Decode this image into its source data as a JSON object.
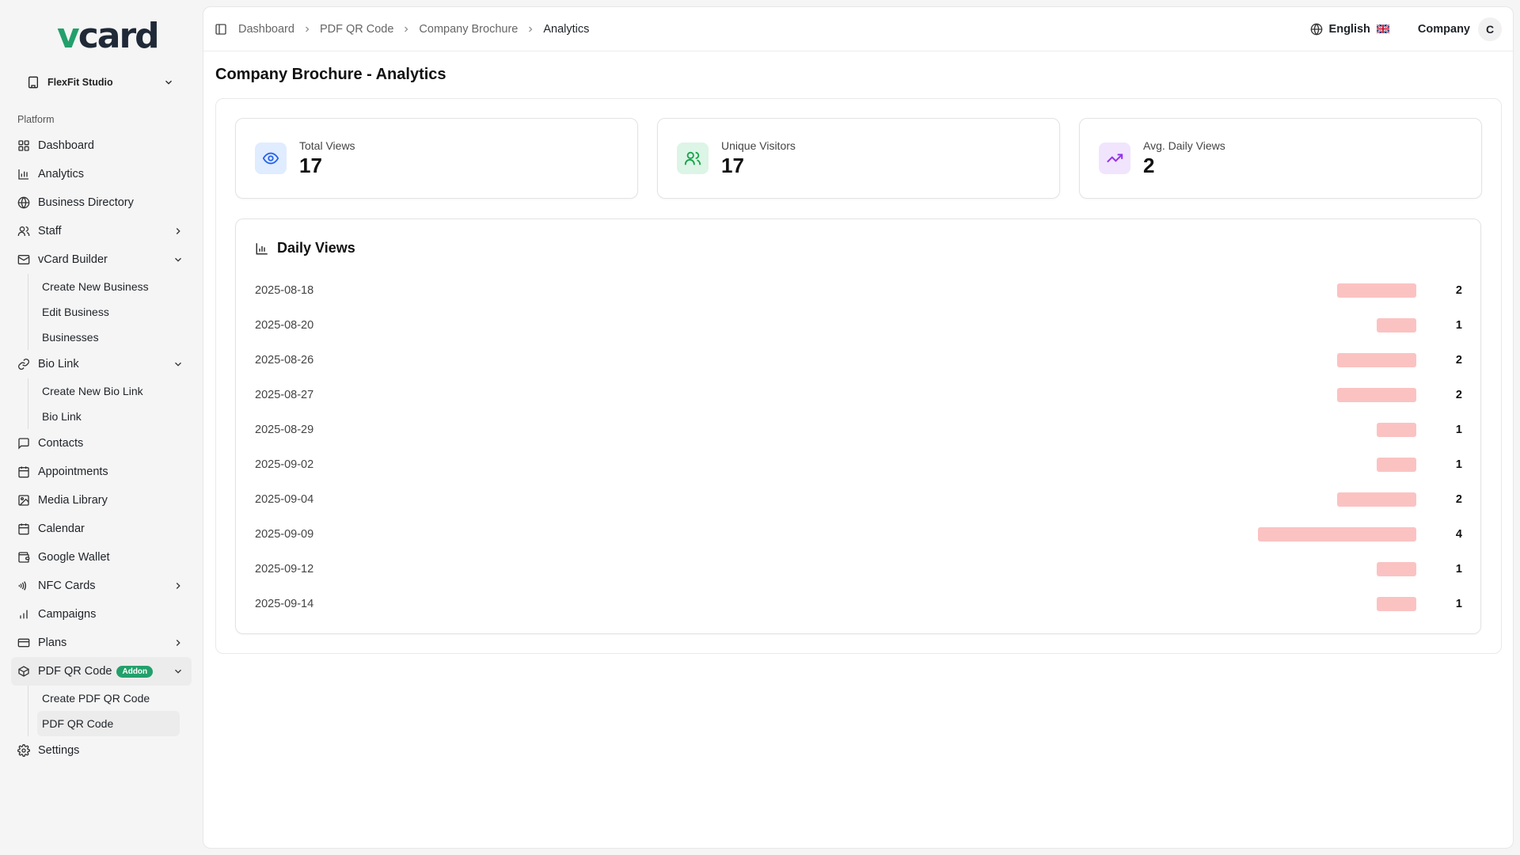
{
  "app": {
    "logo_v": "v",
    "logo_rest": "card"
  },
  "team": {
    "name": "FlexFit Studio"
  },
  "sidebar": {
    "section_label": "Platform",
    "items": [
      {
        "label": "Dashboard",
        "icon": "grid-icon"
      },
      {
        "label": "Analytics",
        "icon": "bar-chart-icon"
      },
      {
        "label": "Business Directory",
        "icon": "globe-icon"
      },
      {
        "label": "Staff",
        "icon": "users-icon"
      },
      {
        "label": "vCard Builder",
        "icon": "mail-icon"
      },
      {
        "label": "Create New Business"
      },
      {
        "label": "Edit Business"
      },
      {
        "label": "Businesses"
      },
      {
        "label": "Bio Link",
        "icon": "link-icon"
      },
      {
        "label": "Create New Bio Link"
      },
      {
        "label": "Bio Link"
      },
      {
        "label": "Contacts",
        "icon": "message-icon"
      },
      {
        "label": "Appointments",
        "icon": "calendar-icon"
      },
      {
        "label": "Media Library",
        "icon": "image-icon"
      },
      {
        "label": "Calendar",
        "icon": "calendar-icon"
      },
      {
        "label": "Google Wallet",
        "icon": "wallet-icon"
      },
      {
        "label": "NFC Cards",
        "icon": "nfc-icon"
      },
      {
        "label": "Campaigns",
        "icon": "bar-chart-icon"
      },
      {
        "label": "Plans",
        "icon": "credit-card-icon"
      },
      {
        "label": "PDF QR Code",
        "icon": "box-icon",
        "badge": "Addon"
      },
      {
        "label": "Create PDF QR Code"
      },
      {
        "label": "PDF QR Code"
      },
      {
        "label": "Settings",
        "icon": "gear-icon"
      }
    ]
  },
  "header": {
    "breadcrumbs": [
      "Dashboard",
      "PDF QR Code",
      "Company Brochure",
      "Analytics"
    ],
    "language": "English",
    "user_name": "Company",
    "avatar_initial": "C"
  },
  "page": {
    "title": "Company Brochure - Analytics"
  },
  "stats": [
    {
      "label": "Total Views",
      "value": "17",
      "icon": "eye-icon",
      "color": "#2563eb",
      "bg": "#e0ecff"
    },
    {
      "label": "Unique Visitors",
      "value": "17",
      "icon": "users-icon",
      "color": "#16a34a",
      "bg": "#dcf5e6"
    },
    {
      "label": "Avg. Daily Views",
      "value": "2",
      "icon": "trending-up-icon",
      "color": "#9333ea",
      "bg": "#f1e4fd"
    }
  ],
  "chart_data": {
    "type": "bar",
    "title": "Daily Views",
    "categories": [
      "2025-08-18",
      "2025-08-20",
      "2025-08-26",
      "2025-08-27",
      "2025-08-29",
      "2025-09-02",
      "2025-09-04",
      "2025-09-09",
      "2025-09-12",
      "2025-09-14"
    ],
    "values": [
      2,
      1,
      2,
      2,
      1,
      1,
      2,
      4,
      1,
      1
    ],
    "orientation": "horizontal",
    "bar_color": "#fbc2c2"
  }
}
